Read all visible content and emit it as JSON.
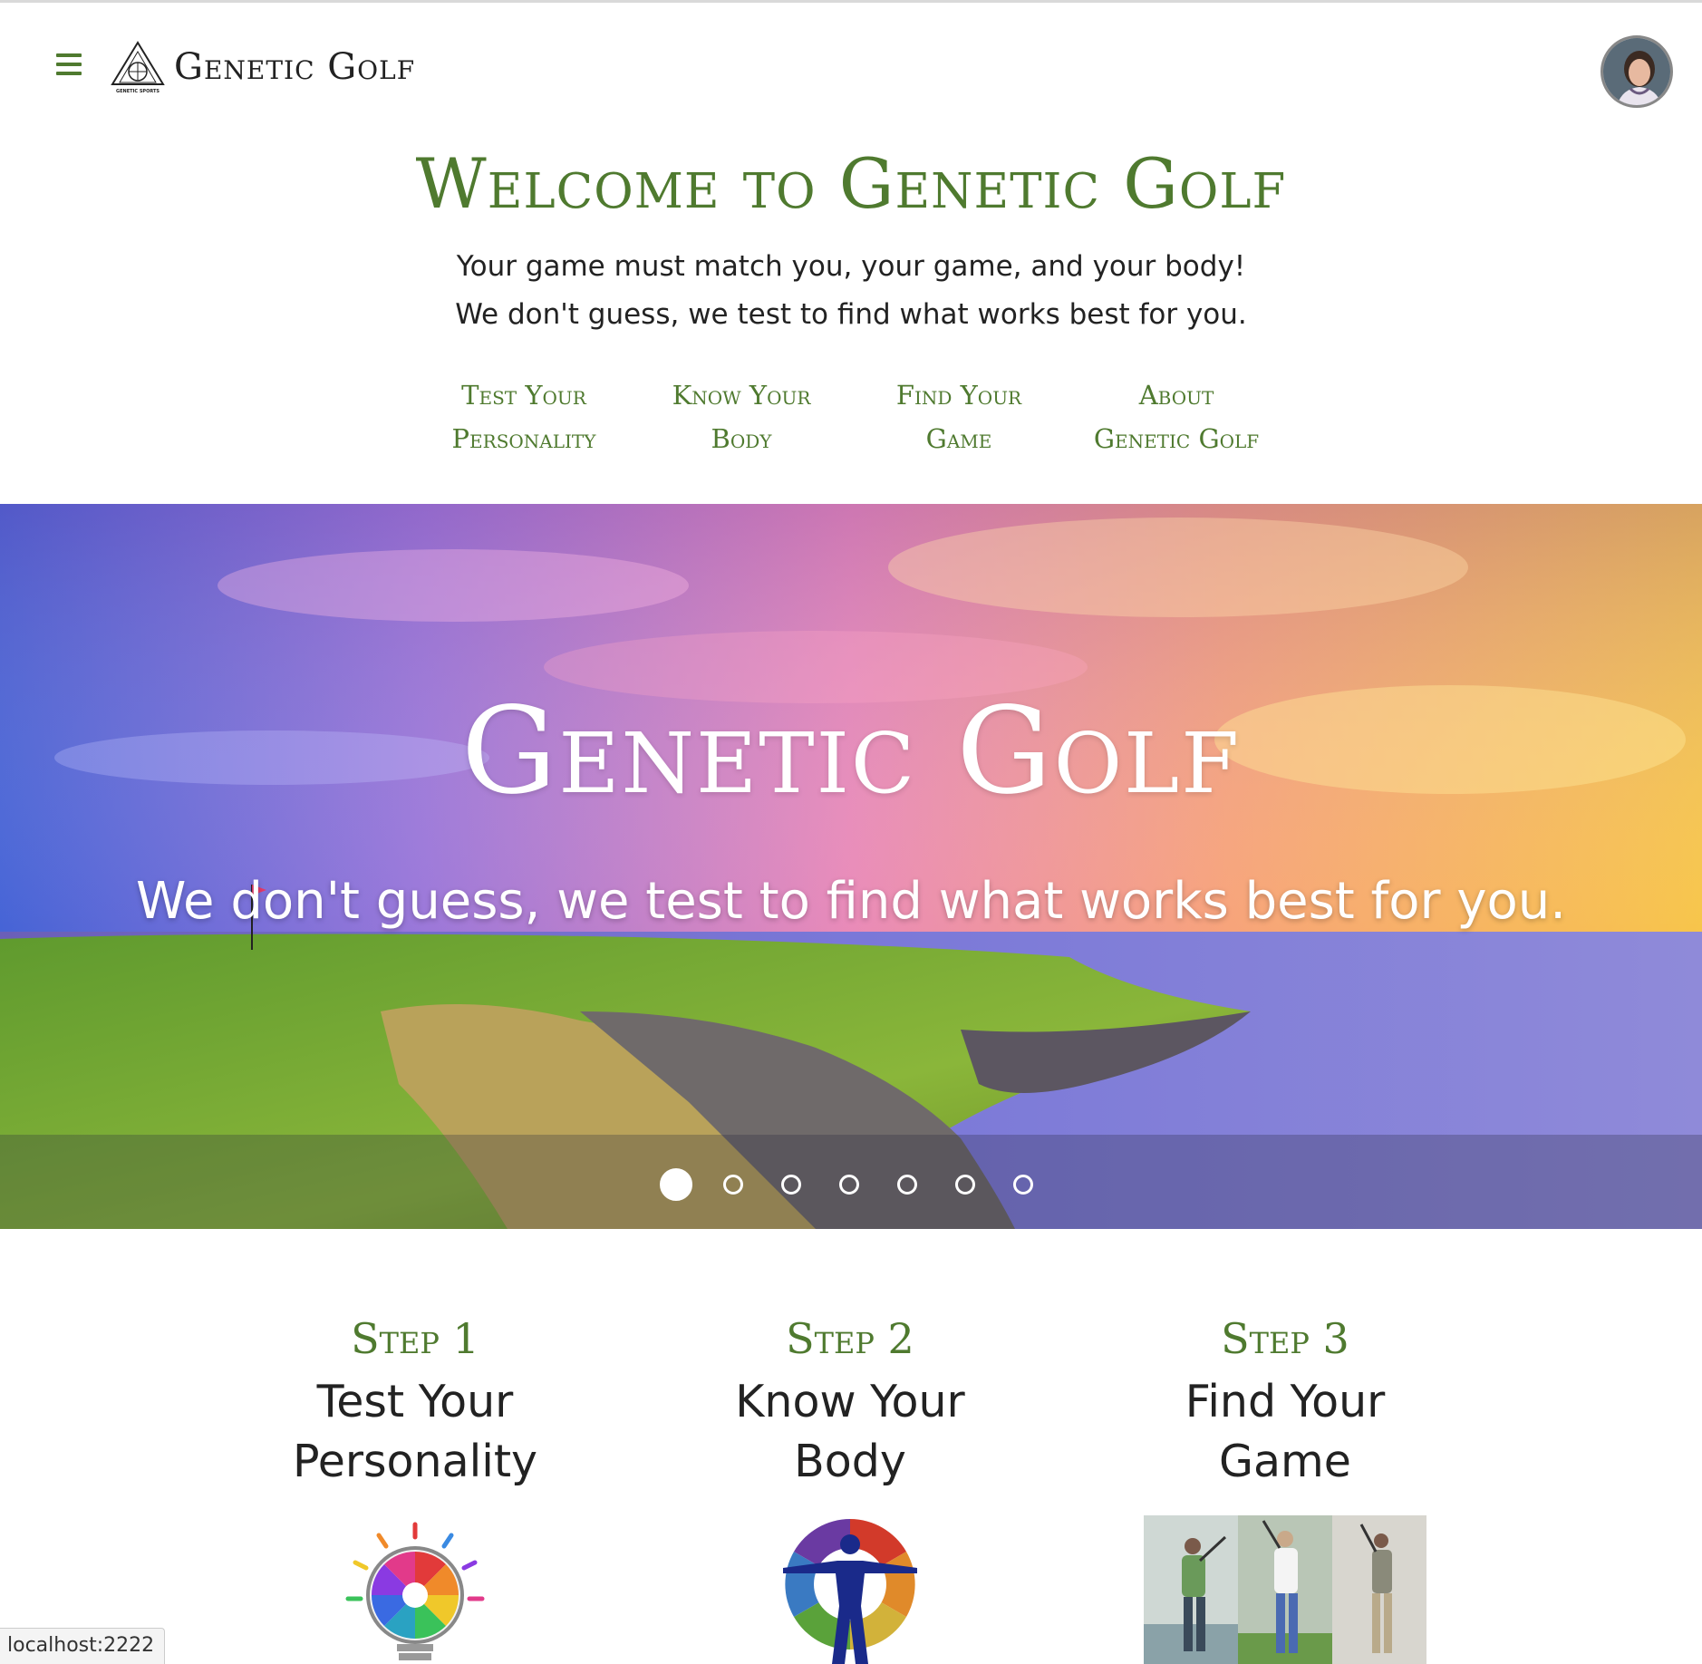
{
  "header": {
    "brand": "Genetic Golf",
    "logo_caption": "GENETIC SPORTS"
  },
  "welcome": {
    "title": "Welcome to Genetic Golf",
    "line1": "Your game must match you, your game, and your body!",
    "line2": "We don't guess, we test to find what works best for you."
  },
  "nav": {
    "items": [
      {
        "line1": "Test Your",
        "line2": "Personality"
      },
      {
        "line1": "Know Your",
        "line2": "Body"
      },
      {
        "line1": "Find Your",
        "line2": "Game"
      },
      {
        "line1": "About",
        "line2": "Genetic Golf"
      }
    ]
  },
  "hero": {
    "title": "Genetic Golf",
    "subtitle": "We don't guess, we test to find what works best for you.",
    "slide_count": 7,
    "active_slide": 1
  },
  "steps": [
    {
      "label": "Step 1",
      "title_line1": "Test Your",
      "title_line2": "Personality",
      "icon": "color-lightbulb-icon"
    },
    {
      "label": "Step 2",
      "title_line1": "Know Your",
      "title_line2": "Body",
      "icon": "human-figure-icon"
    },
    {
      "label": "Step 3",
      "title_line1": "Find Your",
      "title_line2": "Game",
      "icon": "golfers-photo"
    }
  ],
  "status": {
    "url": "localhost:2222"
  },
  "colors": {
    "accent_green": "#4f7a2f",
    "text": "#222222"
  }
}
